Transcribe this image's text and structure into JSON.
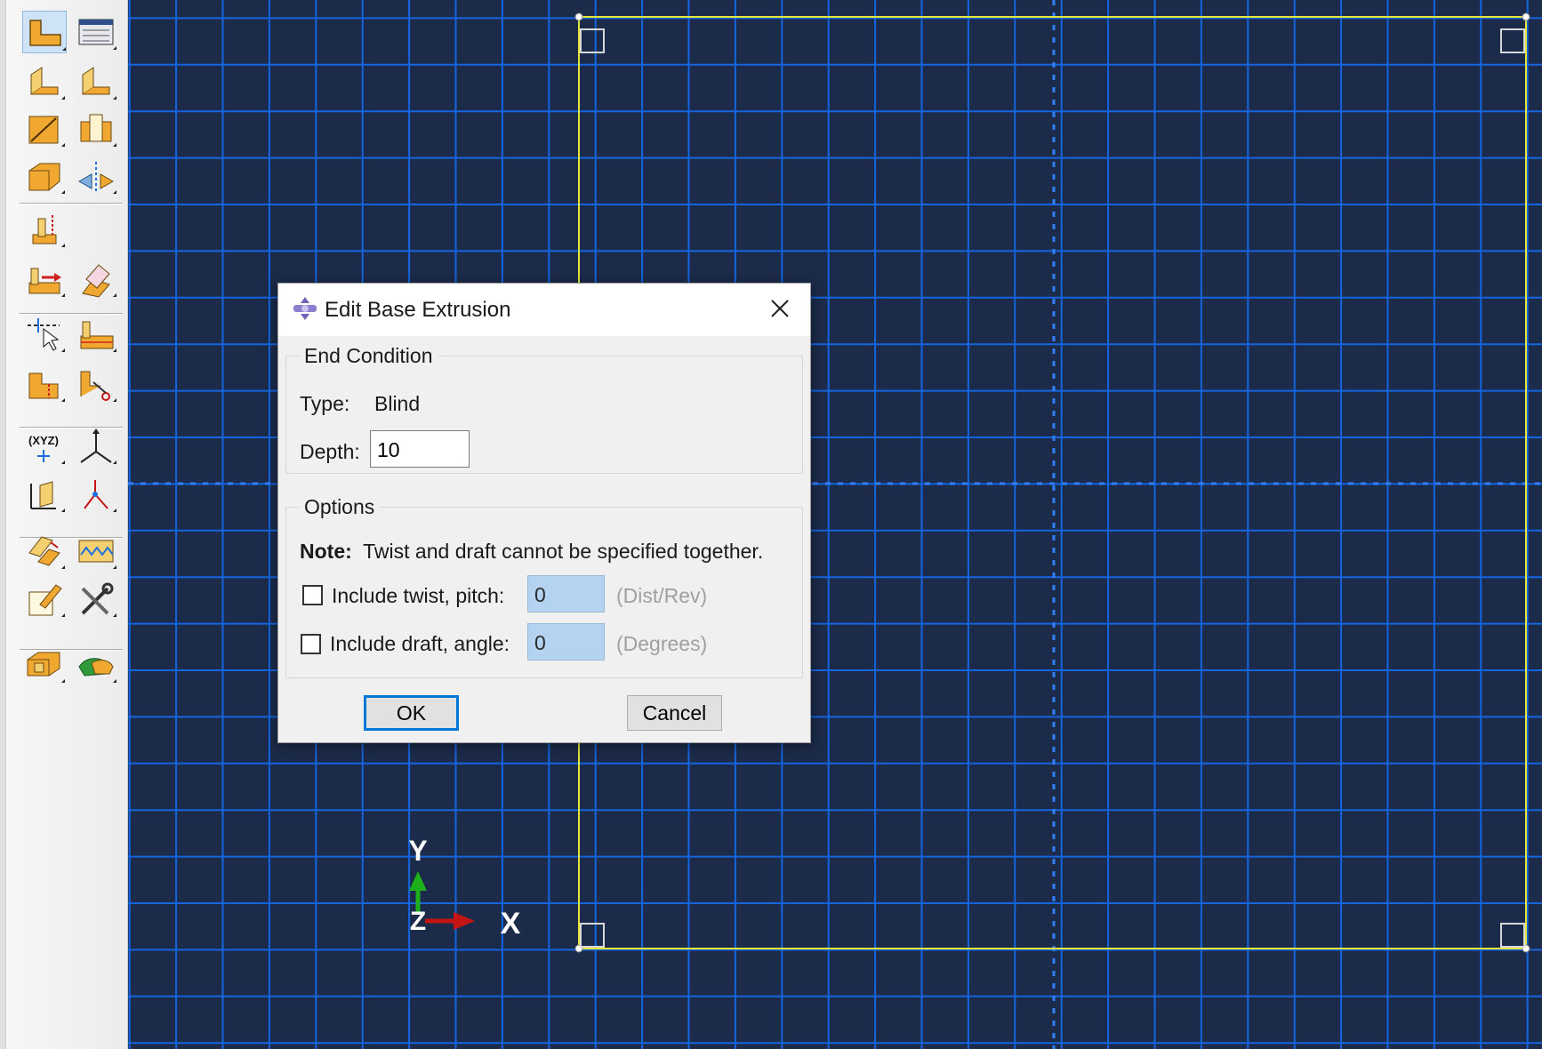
{
  "toolbox": {
    "tools": [
      {
        "id": "create-part-icon"
      },
      {
        "id": "part-manager-icon"
      },
      {
        "id": "create-solid-extrude-icon"
      },
      {
        "id": "create-shell-icon"
      },
      {
        "id": "create-wire-icon"
      },
      {
        "id": "create-cut-icon"
      },
      {
        "id": "create-round-icon"
      },
      {
        "id": "mirror-icon"
      },
      {
        "id": "datum-point-icon"
      },
      {
        "id": "datum-axis-icon"
      },
      {
        "id": "repair-icon"
      },
      {
        "id": "partition-icon"
      },
      {
        "id": "partition-face-icon"
      },
      {
        "id": "partition-cell-icon"
      },
      {
        "id": "cut-partition-icon"
      },
      {
        "id": "coordinate-query-icon"
      },
      {
        "id": "datum-csys-icon"
      },
      {
        "id": "measure-distance-icon"
      },
      {
        "id": "datum-triad-icon"
      },
      {
        "id": "edit-feature-icon"
      },
      {
        "id": "regenerate-icon"
      },
      {
        "id": "edit-sketch-icon"
      },
      {
        "id": "tools-icon"
      },
      {
        "id": "create-assembly-icon"
      },
      {
        "id": "wrap-icon"
      }
    ]
  },
  "triad": {
    "y_label": "Y",
    "x_label": "X",
    "z_label": "Z"
  },
  "dialog": {
    "title": "Edit Base Extrusion",
    "end_condition": {
      "legend": "End Condition",
      "type_label": "Type:",
      "type_value": "Blind",
      "depth_label": "Depth:",
      "depth_value": "10"
    },
    "options": {
      "legend": "Options",
      "note_bold": "Note:",
      "note_text": "Twist and draft cannot be specified together.",
      "twist_label": "Include twist, pitch:",
      "twist_value": "0",
      "twist_unit": "(Dist/Rev)",
      "draft_label": "Include draft, angle:",
      "draft_value": "0",
      "draft_unit": "(Degrees)"
    },
    "ok_label": "OK",
    "cancel_label": "Cancel"
  },
  "colors": {
    "viewport_bg": "#1c2b4a",
    "grid_line": "#1565e0",
    "axis_line": "#2f7fff",
    "sketch_line": "#e4e63a"
  }
}
